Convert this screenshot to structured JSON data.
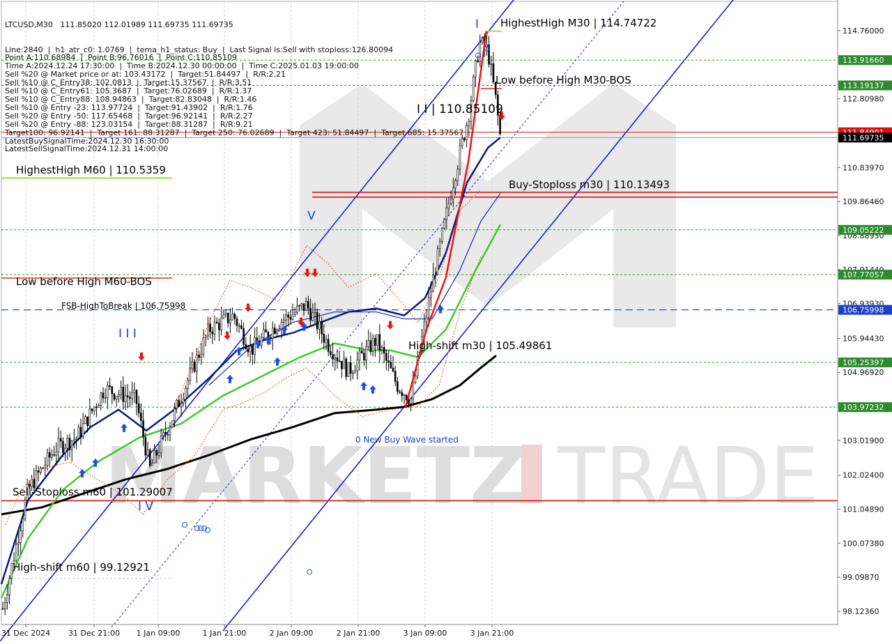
{
  "chart_data": {
    "type": "candlestick",
    "symbol_line": "LTCUSD,M30   111.85020 112.01989 111.69735 111.69735",
    "info_lines": [
      "Line:2840  |  h1_atr_c0: 1.0769  |  tema_h1_status: Buy  |  Last Signal is:Sell with stoploss:126.80094",
      "Point A:110.68984  |  Point B:96.76016  |  Point C:110.85109",
      "Time A:2024.12.24 17:30:00  |  Time B:2024.12.30 00:00:00  |  Time C:2025.01.03 19:00:00",
      "Sell %20 @ Market price or at: 103.43172  |  Target:51.84497  |  R/R:2.21",
      "Sell %10 @ C_Entry38: 102.0813  |  Target:15.37567  |  R/R:3.51",
      "Sell %10 @ C_Entry61: 105.3687  |  Target:76.02689  |  R/R:1.37",
      "Sell %10 @ C_Entry88: 108.94863  |  Target:82.83048  |  R/R:1.46",
      "Sell %10 @ Entry -23: 113.97724  |  Target:91.43902  |  R/R:1.76",
      "Sell %20 @ Entry -50: 117.65468  |  Target:96.92141  |  R/R:2.27",
      "Sell %20 @ Entry -88: 123.03154  |  Target:88.31287  |  R/R:9.21",
      "Target100: 96.92141  |  Target 161: 88.31287  |  Target 250: 76.02689  |  Target 423: 51.84497  |  Target 685: 15.37567",
      "LatestBuySignalTime:2024.12.30 16:30:00",
      "LatestSellSignalTime:2024.12.31 14:00:00"
    ],
    "y_ticks": [
      "114.76000",
      "112.80980",
      "110.83970",
      "109.86460",
      "108.88950",
      "107.91440",
      "106.93930",
      "105.94430",
      "104.96920",
      "103.01900",
      "102.02400",
      "101.04890",
      "100.07380",
      "99.09870",
      "98.12360"
    ],
    "x_ticks": [
      "31 Dec 2024",
      "31 Dec 21:00",
      "1 Jan 09:00",
      "1 Jan 21:00",
      "2 Jan 09:00",
      "2 Jan 21:00",
      "3 Jan 09:00",
      "3 Jan 21:00"
    ],
    "ylim": [
      97.7,
      116.2
    ],
    "price_tags": [
      {
        "value": 113.9166,
        "label": "113.91660",
        "color": "#2e8b2e"
      },
      {
        "value": 113.19137,
        "label": "113.19137",
        "color": "#2e8b2e"
      },
      {
        "value": 111.84901,
        "label": "111.84901",
        "color": "#dd1111"
      },
      {
        "value": 111.69735,
        "label": "111.69735",
        "color": "#000000"
      },
      {
        "value": 109.05222,
        "label": "109.05222",
        "color": "#2e8b2e"
      },
      {
        "value": 107.77057,
        "label": "107.77057",
        "color": "#2e8b2e"
      },
      {
        "value": 106.75998,
        "label": "106.75998",
        "color": "#1a3fcc"
      },
      {
        "value": 105.25397,
        "label": "105.25397",
        "color": "#2e8b2e"
      },
      {
        "value": 103.97232,
        "label": "103.97232",
        "color": "#2e8b2e"
      }
    ],
    "annotations": [
      {
        "text": "HighestHigh   M30 | 114.74722",
        "color": "#000000"
      },
      {
        "text": "Low before High   M30-BOS",
        "color": "#000000"
      },
      {
        "text": "I I | 110.85109",
        "color": "#000000"
      },
      {
        "text": "Buy-Stoploss m30 | 110.13493",
        "color": "#000000"
      },
      {
        "text": "HighestHigh   M60 | 110.5359",
        "color": "#000000"
      },
      {
        "text": "Low before High   M60-BOS",
        "color": "#000000"
      },
      {
        "text": "FSB-HighToBreak | 106.75998",
        "color": "#000000"
      },
      {
        "text": "High-shift m30 | 105.49861",
        "color": "#000000"
      },
      {
        "text": "0 New Buy Wave started",
        "color": "#1a3fcc"
      },
      {
        "text": "Sell-Stoploss m60 | 101.29007",
        "color": "#000000"
      },
      {
        "text": "High-shift m60 | 99.12921",
        "color": "#000000"
      },
      {
        "text": "V",
        "color": "#1a3fcc"
      },
      {
        "text": "I",
        "color": "#1a3fcc"
      },
      {
        "text": "I I I",
        "color": "#1a3fcc"
      },
      {
        "text": "I V",
        "color": "#1a3fcc"
      }
    ],
    "watermark": "MARKETZITRADE",
    "last_price": 111.69735,
    "grid": true
  }
}
